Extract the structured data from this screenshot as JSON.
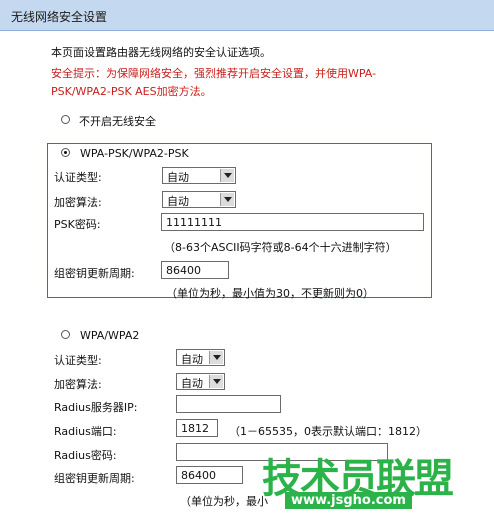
{
  "title": "无线网络安全设置",
  "intro": "本页面设置路由器无线网络的安全认证选项。",
  "warning_line1": "安全提示：为保障网络安全，强烈推荐开启安全设置，并使用WPA-",
  "warning_line2": "PSK/WPA2-PSK AES加密方法。",
  "disable_option": "不开启无线安全",
  "psk_section": {
    "option": "WPA-PSK/WPA2-PSK",
    "auth_label": "认证类型:",
    "auth_value": "自动",
    "enc_label": "加密算法:",
    "enc_value": "自动",
    "psk_label": "PSK密码:",
    "psk_value": "11111111",
    "psk_hint": "（8-63个ASCII码字符或8-64个十六进制字符）",
    "renew_label": "组密钥更新周期:",
    "renew_value": "86400",
    "renew_hint": "（单位为秒，最小值为30，不更新则为0）"
  },
  "enterprise_section": {
    "option": "WPA/WPA2",
    "auth_label": "认证类型:",
    "auth_value": "自动",
    "enc_label": "加密算法:",
    "enc_value": "自动",
    "radius_ip_label": "Radius服务器IP:",
    "radius_ip_value": "",
    "radius_port_label": "Radius端口:",
    "radius_port_value": "1812",
    "radius_port_hint": "（1－65535，0表示默认端口：1812）",
    "radius_pwd_label": "Radius密码:",
    "radius_pwd_value": "",
    "renew_label": "组密钥更新周期:",
    "renew_value": "86400",
    "renew_hint": "（单位为秒，最小"
  },
  "watermark": {
    "name": "技术员联盟",
    "url": "www.jsgho.com"
  },
  "colors": {
    "titlebar": "#c4d8ef",
    "warning": "#c8201c",
    "section_border": "#c83a3a",
    "watermark": "#2bb34a"
  }
}
